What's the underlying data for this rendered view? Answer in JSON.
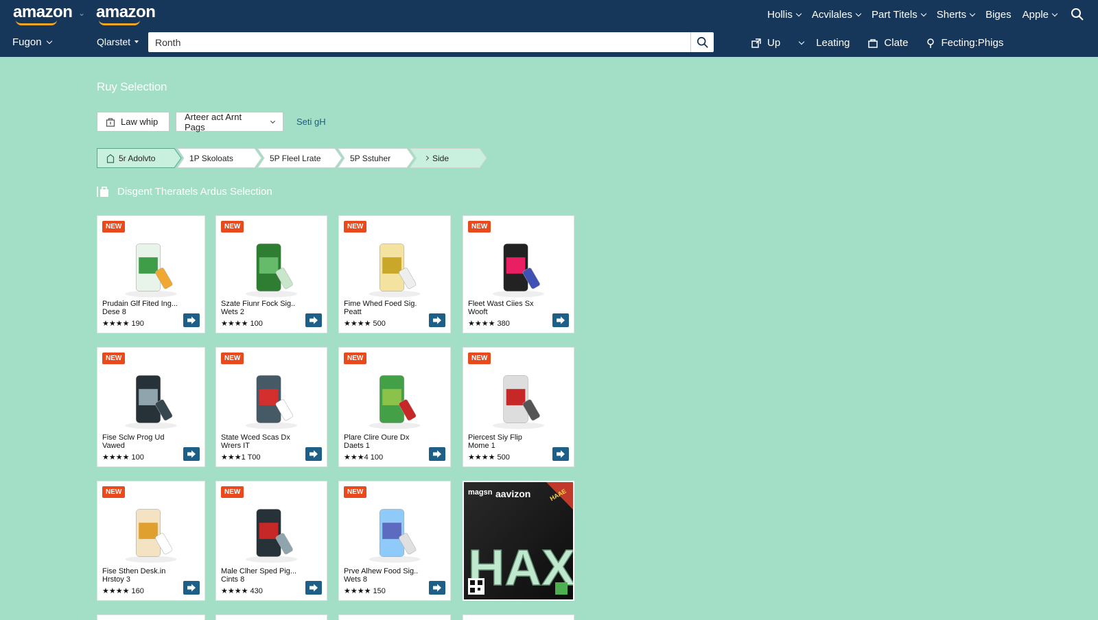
{
  "header": {
    "logo_left": "amazon",
    "logo_right": "amazon",
    "top_nav": [
      "Hollis",
      "Acvilales",
      "Part Titels",
      "Sherts",
      "Biges",
      "Apple"
    ],
    "location": "Fugon",
    "category": "Qlarstet",
    "search_value": "Ronth",
    "right_nav": {
      "up": "Up",
      "leating": "Leating",
      "clate": "Clate",
      "fecting": "Fecting:Phigs"
    }
  },
  "main": {
    "title": "Ruy Selection",
    "toolbar": {
      "button_label": "Law whip",
      "dropdown_value": "Arteer act Arnt Pags",
      "link_label": "Seti gH"
    },
    "breadcrumbs": [
      "5r Adolvto",
      "1P Skoloats",
      "5P Fleel Lrate",
      "5P Sstuher",
      "Side"
    ],
    "section_title": "Disgent Theratels Ardus Selection"
  },
  "products": [
    {
      "badge": "NEW",
      "name": "Prudain Glf Fited Ing...",
      "sub": "Dese 8",
      "stars": "★★★★",
      "count": "190"
    },
    {
      "badge": "NEW",
      "name": "Szate Fiunr Fock Sig..",
      "sub": "Wets 2",
      "stars": "★★★★",
      "count": "100"
    },
    {
      "badge": "NEW",
      "name": "Fime Whed Foed Sig.",
      "sub": "Peatt",
      "stars": "★★★★",
      "count": "500"
    },
    {
      "badge": "NEW",
      "name": "Fleet Wast Ciies Sx",
      "sub": "Wooft",
      "stars": "★★★★",
      "count": "380"
    },
    {
      "badge": "NEW",
      "name": "Fise Sclw Prog Ud",
      "sub": "Vawed",
      "stars": "★★★★",
      "count": "100"
    },
    {
      "badge": "NEW",
      "name": "State Wced Scas Dx",
      "sub": "Wrers IT",
      "stars": "★★★1",
      "count": "T00"
    },
    {
      "badge": "NEW",
      "name": "Plare Clire Oure Dx",
      "sub": "Daets 1",
      "stars": "★★★4",
      "count": "100"
    },
    {
      "badge": "NEW",
      "name": "Piercest Siy Flip",
      "sub": "Mome 1",
      "stars": "★★★★",
      "count": "500"
    },
    {
      "badge": "NEW",
      "name": "Fise Sthen Desk.in",
      "sub": "Hrstoy 3",
      "stars": "★★★★",
      "count": "160"
    },
    {
      "badge": "NEW",
      "name": "Male Clher Sped Pig...",
      "sub": "Cints 8",
      "stars": "★★★★",
      "count": "430"
    },
    {
      "badge": "NEW",
      "name": "Prve Alhew Food Sig..",
      "sub": "Wets 8",
      "stars": "★★★★",
      "count": "150"
    }
  ],
  "ad": {
    "brand_left": "magsn",
    "brand_right": "aavizon",
    "big_text": "HAX",
    "corner": "HAAE"
  },
  "colors": {
    "header": "#16375a",
    "page_bg": "#a2dfc6",
    "badge": "#e8491d",
    "go_button": "#1d5f86",
    "search_icon": "#f5a623"
  }
}
